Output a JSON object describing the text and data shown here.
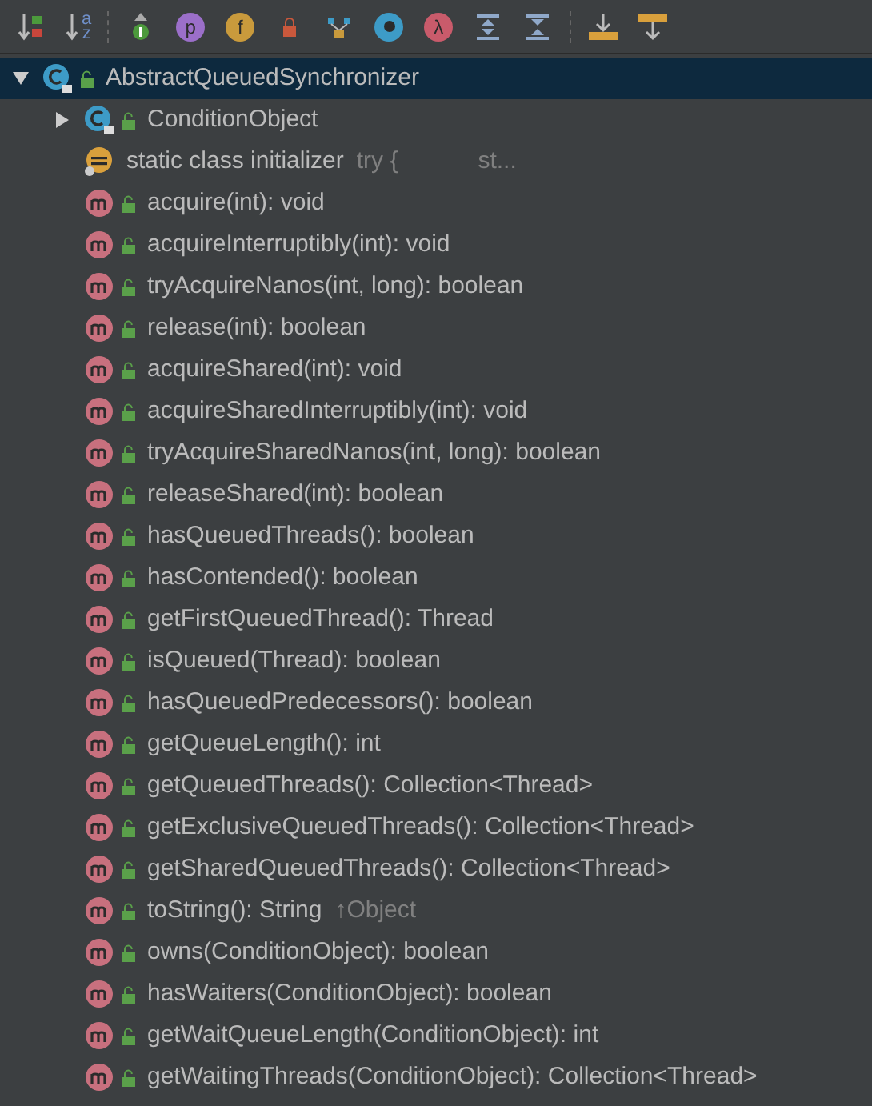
{
  "toolbar": {
    "buttons": [
      {
        "kind": "sort-visibility"
      },
      {
        "kind": "sort-alpha",
        "text": "a",
        "text2": "z"
      },
      {
        "kind": "inherited"
      },
      {
        "kind": "circle",
        "text": "p",
        "color": "#9b6fc9"
      },
      {
        "kind": "circle",
        "text": "f",
        "color": "#c99a3c"
      },
      {
        "kind": "lock"
      },
      {
        "kind": "hierarchy"
      },
      {
        "kind": "dot",
        "color": "#3d9bc7"
      },
      {
        "kind": "circle",
        "text": "λ",
        "color": "#c95b6b"
      },
      {
        "kind": "expand"
      },
      {
        "kind": "collapse"
      },
      {
        "kind": "autoscroll-to"
      },
      {
        "kind": "autoscroll-from"
      }
    ]
  },
  "tree": {
    "label": "AbstractQueuedSynchronizer",
    "kind": "class",
    "expanded": true,
    "selected": true,
    "children": [
      {
        "kind": "class",
        "label": "ConditionObject",
        "expanded": false,
        "selected": false
      },
      {
        "kind": "initializer",
        "label": "static class initializer",
        "suffix": "try {            st...",
        "selected": false
      },
      {
        "kind": "method",
        "label": "acquire(int): void",
        "selected": false
      },
      {
        "kind": "method",
        "label": "acquireInterruptibly(int): void",
        "selected": false
      },
      {
        "kind": "method",
        "label": "tryAcquireNanos(int, long): boolean",
        "selected": false
      },
      {
        "kind": "method",
        "label": "release(int): boolean",
        "selected": false
      },
      {
        "kind": "method",
        "label": "acquireShared(int): void",
        "selected": false
      },
      {
        "kind": "method",
        "label": "acquireSharedInterruptibly(int): void",
        "selected": false
      },
      {
        "kind": "method",
        "label": "tryAcquireSharedNanos(int, long): boolean",
        "selected": false
      },
      {
        "kind": "method",
        "label": "releaseShared(int): boolean",
        "selected": false
      },
      {
        "kind": "method",
        "label": "hasQueuedThreads(): boolean",
        "selected": false
      },
      {
        "kind": "method",
        "label": "hasContended(): boolean",
        "selected": false
      },
      {
        "kind": "method",
        "label": "getFirstQueuedThread(): Thread",
        "selected": false
      },
      {
        "kind": "method",
        "label": "isQueued(Thread): boolean",
        "selected": false
      },
      {
        "kind": "method",
        "label": "hasQueuedPredecessors(): boolean",
        "selected": false
      },
      {
        "kind": "method",
        "label": "getQueueLength(): int",
        "selected": false
      },
      {
        "kind": "method",
        "label": "getQueuedThreads(): Collection<Thread>",
        "selected": false
      },
      {
        "kind": "method",
        "label": "getExclusiveQueuedThreads(): Collection<Thread>",
        "selected": false
      },
      {
        "kind": "method",
        "label": "getSharedQueuedThreads(): Collection<Thread>",
        "selected": false
      },
      {
        "kind": "method",
        "label": "toString(): String",
        "suffix": "↑Object",
        "selected": false
      },
      {
        "kind": "method",
        "label": "owns(ConditionObject): boolean",
        "selected": false
      },
      {
        "kind": "method",
        "label": "hasWaiters(ConditionObject): boolean",
        "selected": false
      },
      {
        "kind": "method",
        "label": "getWaitQueueLength(ConditionObject): int",
        "selected": false
      },
      {
        "kind": "method",
        "label": "getWaitingThreads(ConditionObject): Collection<Thread>",
        "selected": false
      }
    ]
  }
}
